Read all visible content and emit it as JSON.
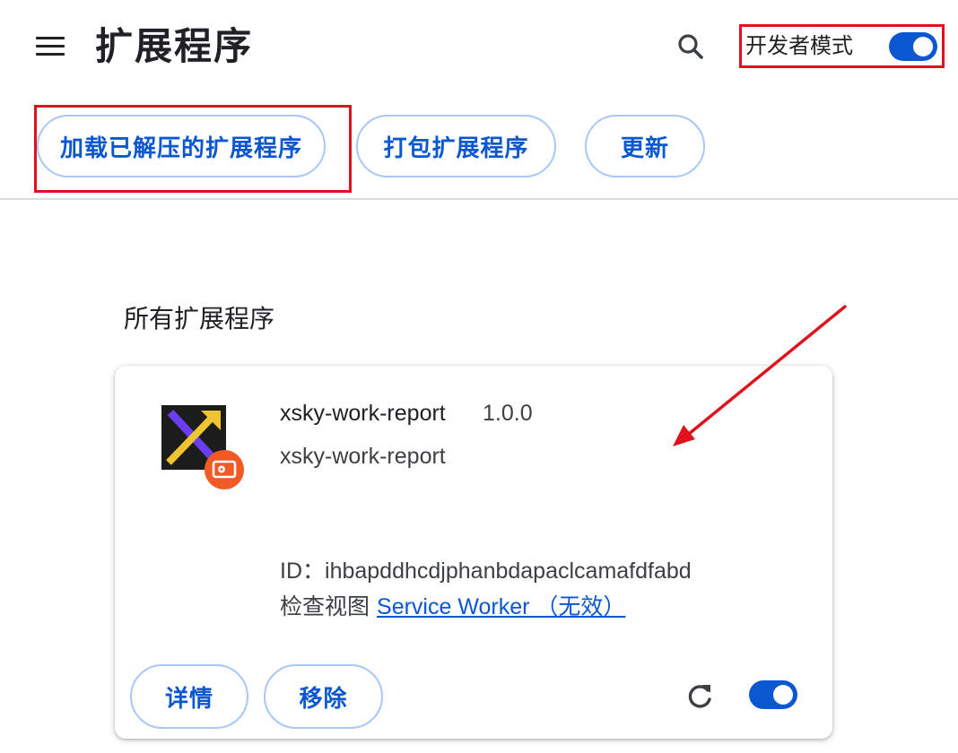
{
  "header": {
    "title": "扩展程序",
    "menu_icon": "menu-icon",
    "search_icon": "search-icon",
    "dev_mode_label": "开发者模式",
    "dev_mode_enabled": true
  },
  "toolbar": {
    "load_unpacked_label": "加载已解压的扩展程序",
    "pack_label": "打包扩展程序",
    "update_label": "更新"
  },
  "section": {
    "title": "所有扩展程序"
  },
  "extension": {
    "name": "xsky-work-report",
    "version": "1.0.0",
    "description": "xsky-work-report",
    "id_label": "ID：",
    "id_value": "ihbapddhcdjphanbdapaclcamafdfabd",
    "inspect_label": "检查视图",
    "inspect_link": "Service Worker （无效）",
    "details_label": "详情",
    "remove_label": "移除",
    "enabled": true,
    "icon": "xsky-logo-icon",
    "badge_icon": "unpacked-badge-icon"
  },
  "colors": {
    "accent": "#0b57d0",
    "highlight_box": "#e0101c",
    "annotation_arrow": "#e0101c"
  }
}
